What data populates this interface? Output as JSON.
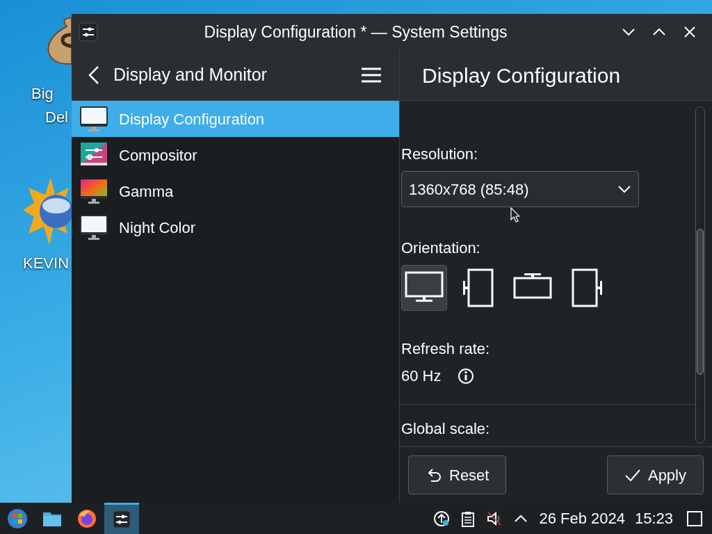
{
  "desktop": {
    "icons": [
      {
        "kind": "money-bag",
        "label_lines": [
          "Big",
          "Del"
        ]
      },
      {
        "kind": "sun-globe",
        "label_lines": [
          "KEVIN"
        ]
      }
    ]
  },
  "window": {
    "title": "Display Configuration * — System Settings"
  },
  "sidebar": {
    "title": "Display and Monitor",
    "items": [
      {
        "label": "Display Configuration",
        "kind": "display",
        "selected": true
      },
      {
        "label": "Compositor",
        "kind": "compositor",
        "selected": false
      },
      {
        "label": "Gamma",
        "kind": "gamma",
        "selected": false
      },
      {
        "label": "Night Color",
        "kind": "display",
        "selected": false
      }
    ]
  },
  "page": {
    "title": "Display Configuration",
    "resolution": {
      "label": "Resolution:",
      "value": "1360x768 (85:48)"
    },
    "orientation": {
      "label": "Orientation:",
      "options": [
        {
          "kind": "landscape",
          "selected": true
        },
        {
          "kind": "portrait-left",
          "selected": false
        },
        {
          "kind": "landscape-flipped",
          "selected": false
        },
        {
          "kind": "portrait-right",
          "selected": false
        }
      ]
    },
    "refresh_rate": {
      "label": "Refresh rate:",
      "value": "60 Hz"
    },
    "global_scale": {
      "label": "Global scale:"
    }
  },
  "buttons": [
    {
      "kind": "reset",
      "label": "Reset"
    },
    {
      "kind": "apply",
      "label": "Apply"
    }
  ],
  "taskbar": {
    "apps": [
      {
        "kind": "start",
        "selected": false
      },
      {
        "kind": "files",
        "selected": false
      },
      {
        "kind": "browser",
        "selected": false
      },
      {
        "kind": "settings",
        "selected": true
      }
    ],
    "date": "26 Feb 2024",
    "time": "15:23"
  }
}
